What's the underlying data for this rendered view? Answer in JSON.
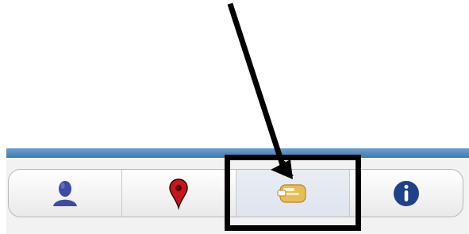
{
  "toolbar": {
    "buttons": [
      {
        "icon": "person-icon",
        "color": "#3a49a0"
      },
      {
        "icon": "map-pin-icon",
        "color": "#c0151b"
      },
      {
        "icon": "message-bubble-icon",
        "color": "#e2b64b",
        "selected": true
      },
      {
        "icon": "info-icon",
        "color": "#1d3f86"
      }
    ]
  },
  "annotation": {
    "arrow_color": "#000000",
    "box_color": "#000000"
  }
}
